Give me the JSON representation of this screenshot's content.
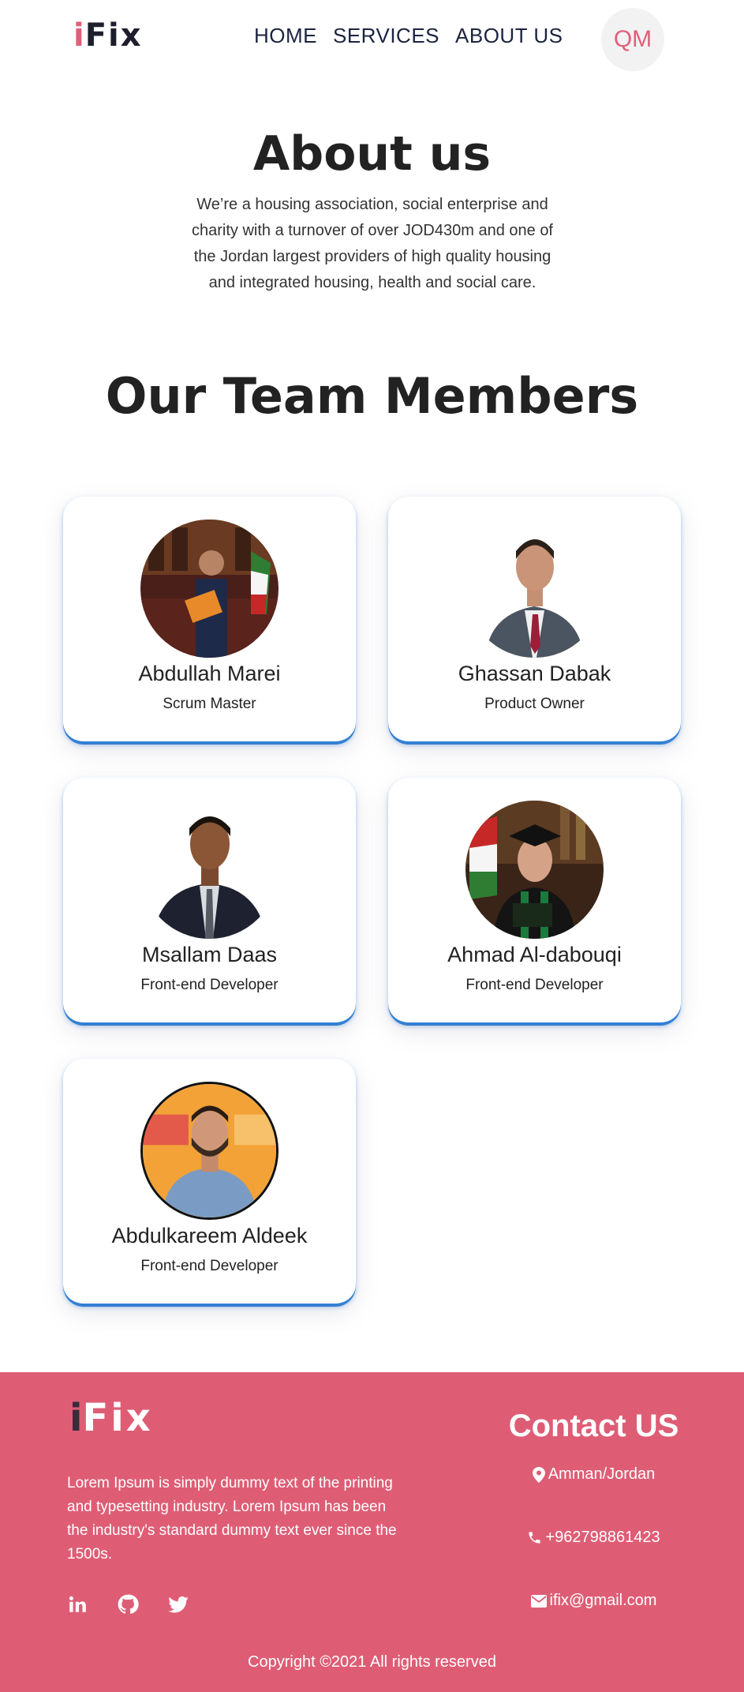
{
  "header": {
    "logo_i": "i",
    "logo_rest": "Fix",
    "nav": [
      "HOME",
      "SERVICES",
      "ABOUT US"
    ],
    "avatar_initials": "QM"
  },
  "about": {
    "title": "About us",
    "text": "We’re a housing association, social enterprise and charity with a turnover of over JOD430m and one of the Jordan largest providers of high quality housing and integrated housing, health and social care."
  },
  "team": {
    "title": "Our Team Members",
    "members": [
      {
        "name": "Abdullah Marei",
        "role": "Scrum Master"
      },
      {
        "name": "Ghassan Dabak",
        "role": "Product Owner"
      },
      {
        "name": "Msallam Daas",
        "role": "Front-end Developer"
      },
      {
        "name": "Ahmad Al-dabouqi",
        "role": "Front-end Developer"
      },
      {
        "name": "Abdulkareem Aldeek",
        "role": "Front-end Developer"
      }
    ]
  },
  "footer": {
    "logo_i": "i",
    "logo_rest": "Fix",
    "lorem": "Lorem Ipsum is simply dummy text of the printing and typesetting industry. Lorem Ipsum has been the industry's standard dummy text ever since the 1500s.",
    "social": [
      "linkedin-icon",
      "github-icon",
      "twitter-icon"
    ],
    "contact_title": "Contact US",
    "location": "Amman/Jordan",
    "phone": "+962798861423",
    "email": "ifix@gmail.com",
    "copyright": "Copyright ©2021 All rights reserved"
  },
  "colors": {
    "brand_pink": "#de5d75",
    "accent_blue": "#2f80d8",
    "nav_text": "#1b2440"
  }
}
